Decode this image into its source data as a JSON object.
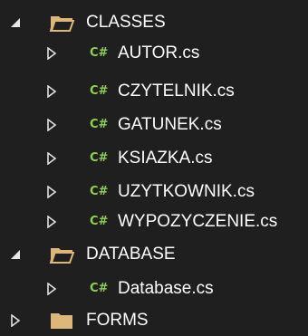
{
  "tree": {
    "classes_folder": {
      "label": "CLASSES",
      "expanded": true,
      "icon": "folder-open-icon"
    },
    "classes_files": [
      {
        "label": "AUTOR.cs",
        "icon": "csharp-file-icon",
        "badge": "C#"
      },
      {
        "label": "CZYTELNIK.cs",
        "icon": "csharp-file-icon",
        "badge": "C#"
      },
      {
        "label": "GATUNEK.cs",
        "icon": "csharp-file-icon",
        "badge": "C#"
      },
      {
        "label": "KSIAZKA.cs",
        "icon": "csharp-file-icon",
        "badge": "C#"
      },
      {
        "label": "UZYTKOWNIK.cs",
        "icon": "csharp-file-icon",
        "badge": "C#"
      },
      {
        "label": "WYPOZYCZENIE.cs",
        "icon": "csharp-file-icon",
        "badge": "C#"
      }
    ],
    "database_folder": {
      "label": "DATABASE",
      "expanded": true,
      "icon": "folder-open-icon"
    },
    "database_files": [
      {
        "label": "Database.cs",
        "icon": "csharp-file-icon",
        "badge": "C#"
      }
    ],
    "forms_folder": {
      "label": "FORMS",
      "expanded": false,
      "icon": "folder-closed-icon"
    }
  },
  "colors": {
    "background": "#1f1f1f",
    "text": "#ffffff",
    "csharp_badge": "#8fd14f",
    "folder": "#dcb67a",
    "arrow": "#e0e0e0"
  }
}
